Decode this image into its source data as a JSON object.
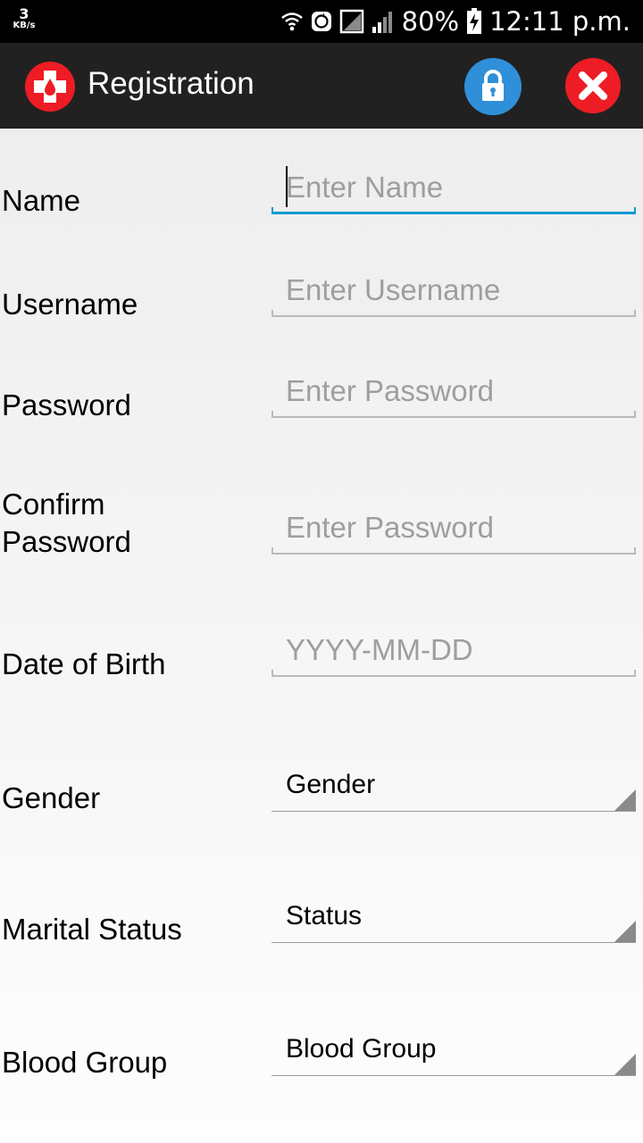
{
  "status_bar": {
    "speed_value": "3",
    "speed_unit": "KB/s",
    "battery": "80%",
    "time": "12:11 p.m.",
    "icons": [
      "wifi-icon",
      "sync-icon",
      "no-sim-icon",
      "cell-signal-icon",
      "battery-charging-icon"
    ]
  },
  "app_bar": {
    "title": "Registration",
    "logo_icon": "blood-donation-cross-icon",
    "actions": [
      {
        "name": "lock-icon",
        "color": "#2f8fd8"
      },
      {
        "name": "close-icon",
        "color": "#ee1c24"
      }
    ]
  },
  "form": {
    "name": {
      "label": "Name",
      "placeholder": "Enter Name",
      "value": ""
    },
    "username": {
      "label": "Username",
      "placeholder": "Enter Username",
      "value": ""
    },
    "password": {
      "label": "Password",
      "placeholder": "Enter Password",
      "value": ""
    },
    "confirm_password": {
      "label_line1": "Confirm",
      "label_line2": "Password",
      "placeholder": "Enter Password",
      "value": ""
    },
    "dob": {
      "label": "Date of Birth",
      "placeholder": "YYYY-MM-DD",
      "value": ""
    },
    "gender": {
      "label": "Gender",
      "selected": "Gender"
    },
    "marital_status": {
      "label": "Marital Status",
      "selected": "Status"
    },
    "blood_group": {
      "label": "Blood Group",
      "selected": "Blood Group"
    }
  },
  "colors": {
    "accent": "#0d9ad1",
    "app_bar": "#212121",
    "status_bar": "#000000",
    "brand_red": "#ee1c24"
  }
}
